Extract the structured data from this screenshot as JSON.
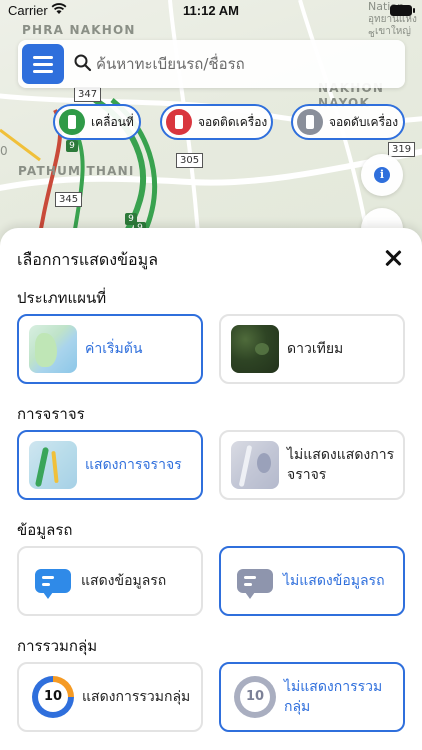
{
  "status_bar": {
    "carrier": "Carrier",
    "time": "11:12 AM"
  },
  "map": {
    "places": [
      "PHRA NAKHON",
      "NAKHON",
      "NAYOK",
      "PATHUM THANI",
      "Nation",
      "อุทยานแห่งช",
      "เขาใหญ่"
    ],
    "route_shields": [
      "347",
      "305",
      "345",
      "319"
    ],
    "mini_shields": [
      "9",
      "9",
      "9"
    ],
    "left_edge_label": "0"
  },
  "search": {
    "placeholder": "ค้นหาทะเบียนรถ/ชื่อรถ"
  },
  "filters": [
    {
      "label": "เคลื่อนที่",
      "color": "#2f9a47"
    },
    {
      "label": "จอดติดเครื่อง",
      "color": "#d9363e"
    },
    {
      "label": "จอดดับเครื่อง",
      "color": "#8a8f9a"
    }
  ],
  "sheet": {
    "title": "เลือกการแสดงข้อมูล",
    "sections": [
      {
        "title": "ประเภทแผนที่",
        "options": [
          {
            "label": "ค่าเริ่มต้น",
            "selected": true,
            "icon": "default-map-thumbnail"
          },
          {
            "label": "ดาวเทียม",
            "selected": false,
            "icon": "satellite-map-thumbnail"
          }
        ]
      },
      {
        "title": "การจราจร",
        "options": [
          {
            "label": "แสดงการจราจร",
            "selected": true,
            "icon": "traffic-map-thumbnail"
          },
          {
            "label": "ไม่แสดงแสดงการจราจร",
            "selected": false,
            "icon": "no-traffic-map-thumbnail"
          }
        ]
      },
      {
        "title": "ข้อมูลรถ",
        "options": [
          {
            "label": "แสดงข้อมูลรถ",
            "selected": false,
            "icon": "vehicle-info-icon"
          },
          {
            "label": "ไม่แสดงข้อมูลรถ",
            "selected": true,
            "icon": "vehicle-info-hidden-icon"
          }
        ]
      },
      {
        "title": "การรวมกลุ่ม",
        "options": [
          {
            "label": "แสดงการรวมกลุ่ม",
            "selected": false,
            "icon": "cluster-icon",
            "count": "10"
          },
          {
            "label": "ไม่แสดงการรวมกลุ่ม",
            "selected": true,
            "icon": "cluster-hidden-icon",
            "count": "10"
          }
        ]
      }
    ]
  },
  "colors": {
    "accent": "#2f6fdc",
    "card_border": "#e3e3e3",
    "selected_text": "#2f6fdc"
  }
}
